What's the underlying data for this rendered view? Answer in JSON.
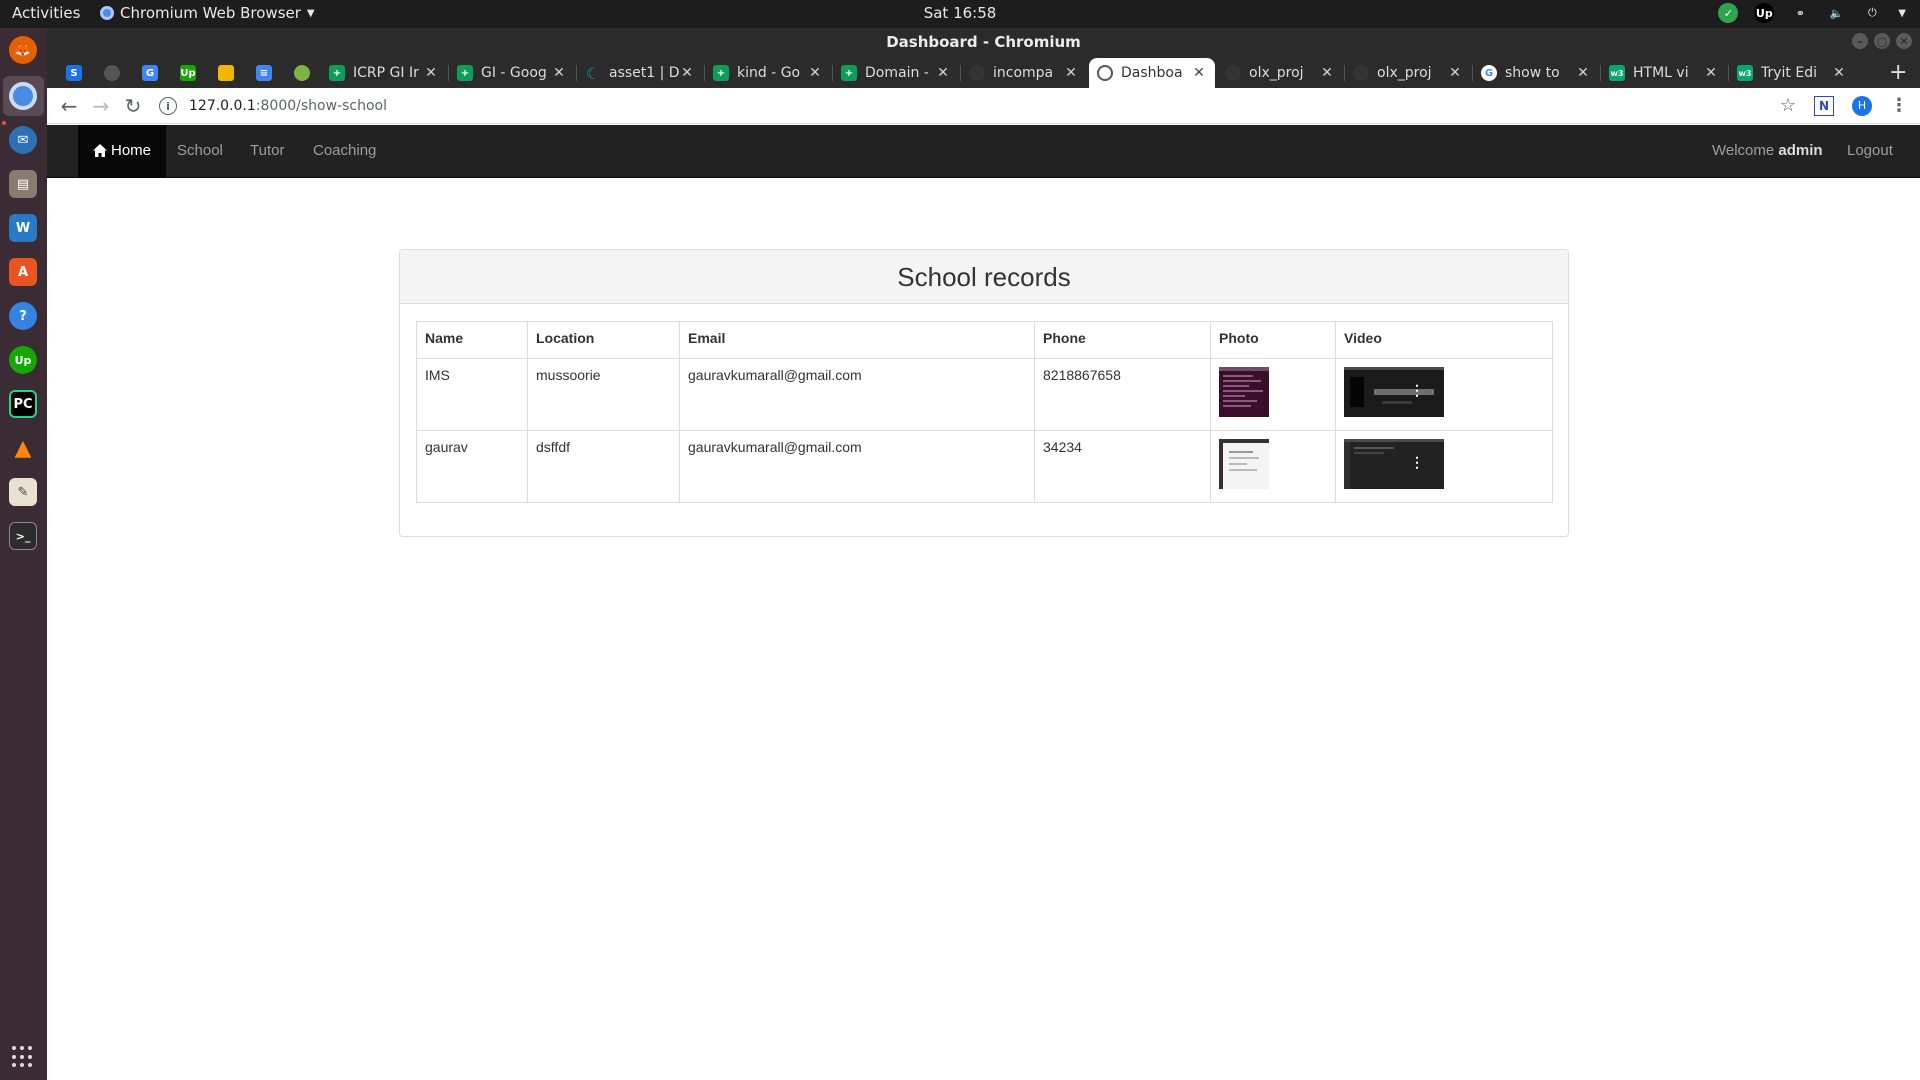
{
  "os": {
    "activities": "Activities",
    "app_menu": "Chromium Web Browser",
    "clock": "Sat 16:58"
  },
  "window": {
    "title": "Dashboard - Chromium"
  },
  "tabs": [
    {
      "label": "ICRP GI Ir"
    },
    {
      "label": "GI - Goog"
    },
    {
      "label": "asset1 | D"
    },
    {
      "label": "kind - Go"
    },
    {
      "label": "Domain -"
    },
    {
      "label": "incompa"
    },
    {
      "label": "Dashboa"
    },
    {
      "label": "olx_proj"
    },
    {
      "label": "olx_proj"
    },
    {
      "label": "show to"
    },
    {
      "label": "HTML vi"
    },
    {
      "label": "Tryit Edi"
    }
  ],
  "address": {
    "host": "127.0.0.1",
    "path": ":8000/show-school"
  },
  "nav": {
    "home": "Home",
    "school": "School",
    "tutor": "Tutor",
    "coaching": "Coaching",
    "welcome": "Welcome",
    "user": "admin",
    "logout": "Logout"
  },
  "panel": {
    "title": "School records"
  },
  "table": {
    "headers": [
      "Name",
      "Location",
      "Email",
      "Phone",
      "Photo",
      "Video"
    ],
    "rows": [
      {
        "name": "IMS",
        "location": "mussoorie",
        "email": "gauravkumarall@gmail.com",
        "phone": "8218867658"
      },
      {
        "name": "gaurav",
        "location": "dsffdf",
        "email": "gauravkumarall@gmail.com",
        "phone": "34234"
      }
    ]
  },
  "colors": {
    "navbar": "#222222",
    "navbar_active": "#080808",
    "panel_head": "#f5f5f5",
    "dock": "#3a2b34"
  }
}
